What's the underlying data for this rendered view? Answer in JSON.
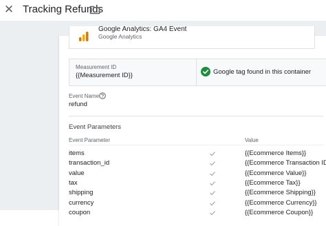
{
  "header": {
    "title": "Tracking Refunds",
    "close_icon": "close-icon",
    "folder_icon": "folder-icon"
  },
  "tag_card": {
    "name": "Google Analytics: GA4 Event",
    "subtitle": "Google Analytics"
  },
  "measurement": {
    "label": "Measurement ID",
    "value": "{{Measurement ID}}",
    "status": "Google tag found in this container",
    "status_color": "#1e8e3e"
  },
  "event": {
    "label": "Event Name",
    "value": "refund"
  },
  "params": {
    "title": "Event Parameters",
    "col_param": "Event Parameter",
    "col_value": "Value",
    "rows": [
      {
        "name": "items",
        "value": "{{Ecommerce Items}}"
      },
      {
        "name": "transaction_id",
        "value": "{{Ecommerce Transaction ID}}"
      },
      {
        "name": "value",
        "value": "{{Ecommerce Value}}"
      },
      {
        "name": "tax",
        "value": "{{Ecommerce Tax}}"
      },
      {
        "name": "shipping",
        "value": "{{Ecommerce Shipping}}"
      },
      {
        "name": "currency",
        "value": "{{Ecommerce Currency}}"
      },
      {
        "name": "coupon",
        "value": "{{Ecommerce Coupon}}"
      }
    ]
  }
}
